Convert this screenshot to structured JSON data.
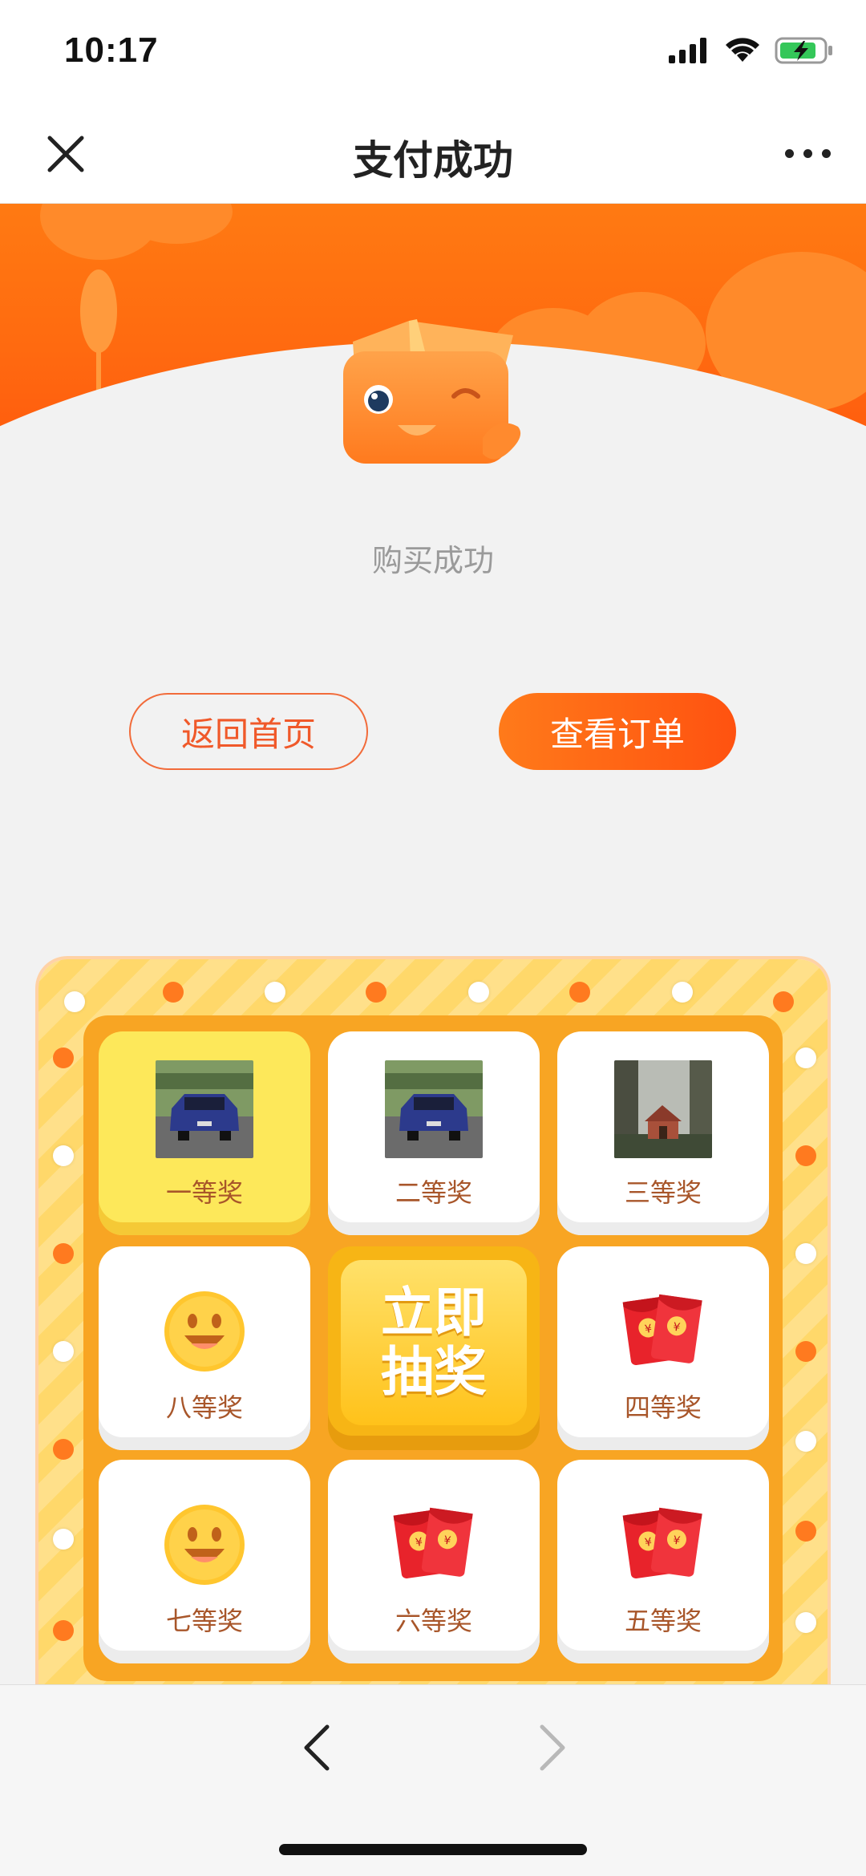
{
  "status_bar": {
    "time": "10:17",
    "icons": [
      "signal-icon",
      "wifi-icon",
      "battery-charging-icon"
    ]
  },
  "nav": {
    "title": "支付成功",
    "left_icon": "close-icon",
    "right_icon": "more-icon"
  },
  "result": {
    "message": "购买成功",
    "primary_button": "查看订单",
    "secondary_button": "返回首页"
  },
  "lottery": {
    "start_label_line1": "立即",
    "start_label_line2": "抽奖",
    "prizes": [
      {
        "label": "一等奖",
        "icon": "car-photo",
        "active": true
      },
      {
        "label": "二等奖",
        "icon": "car-photo"
      },
      {
        "label": "三等奖",
        "icon": "house-photo"
      },
      {
        "label": "四等奖",
        "icon": "red-envelope-icon"
      },
      {
        "label": "五等奖",
        "icon": "red-envelope-icon"
      },
      {
        "label": "六等奖",
        "icon": "red-envelope-icon"
      },
      {
        "label": "七等奖",
        "icon": "smiley-icon"
      },
      {
        "label": "八等奖",
        "icon": "smiley-icon"
      }
    ]
  },
  "toolbar": {
    "back_icon": "chevron-left-icon",
    "forward_icon": "chevron-right-icon"
  },
  "colors": {
    "brand_orange": "#ff6a10",
    "board_yellow": "#ffd86a",
    "board_inner": "#f8a523",
    "active_cell": "#fde85a",
    "prize_text": "#a8562a"
  }
}
